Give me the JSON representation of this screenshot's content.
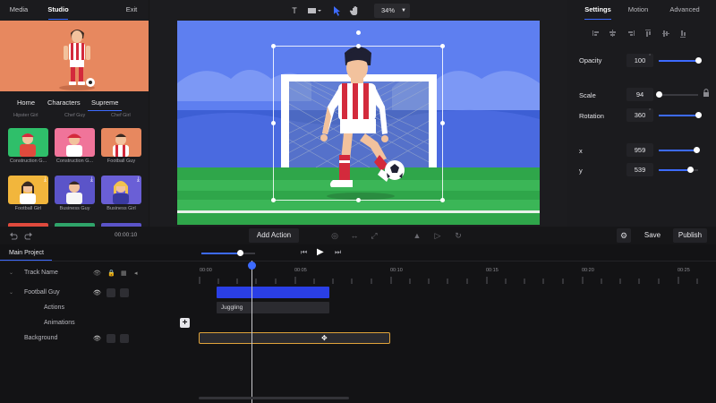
{
  "left_panel": {
    "tabs": [
      {
        "label": "Media"
      },
      {
        "label": "Studio"
      },
      {
        "label": "Exit"
      }
    ],
    "category_tabs": [
      {
        "label": "Home"
      },
      {
        "label": "Characters"
      },
      {
        "label": "Supreme"
      }
    ],
    "faded_row": [
      "Hipster Girl",
      "Chef Guy",
      "Chef Girl"
    ],
    "cards": [
      {
        "label": "Construction G...",
        "bg": "#2fbf6a"
      },
      {
        "label": "Construction G...",
        "bg": "#f0749a"
      },
      {
        "label": "Football Guy",
        "bg": "#e7885f"
      },
      {
        "label": "Football Girl",
        "bg": "#f2b63c"
      },
      {
        "label": "Business Guy",
        "bg": "#5b54c9"
      },
      {
        "label": "Business Girl",
        "bg": "#6a5fd6"
      }
    ],
    "time_display": "00:00:10"
  },
  "toolbar": {
    "text_tool": "T",
    "zoom": "34%"
  },
  "right_panel": {
    "tabs": [
      {
        "label": "Settings"
      },
      {
        "label": "Motion"
      },
      {
        "label": "Advanced"
      }
    ],
    "properties": {
      "opacity": {
        "label": "Opacity",
        "value": "100",
        "level": 1.0
      },
      "scale": {
        "label": "Scale",
        "value": "94",
        "level": 0.02
      },
      "rotation": {
        "label": "Rotation",
        "value": "360",
        "level": 1.0
      },
      "x": {
        "label": "x",
        "value": "959",
        "level": 0.96
      },
      "y": {
        "label": "y",
        "value": "539",
        "level": 0.8
      }
    }
  },
  "action_bar": {
    "add_action": "Add Action",
    "save": "Save",
    "publish": "Publish"
  },
  "timeline": {
    "project_tab": "Main Project",
    "ticks": [
      "00:00",
      "00:05",
      "00:10",
      "00:15",
      "00:20",
      "00:25"
    ],
    "rows": {
      "track_name": "Track Name",
      "football_guy": "Football Guy",
      "actions": "Actions",
      "animations": "Animations",
      "background": "Background"
    },
    "animation_clip": "Juggling"
  },
  "colors": {
    "accent": "#3d6bff",
    "selection": "#e0a33a"
  }
}
